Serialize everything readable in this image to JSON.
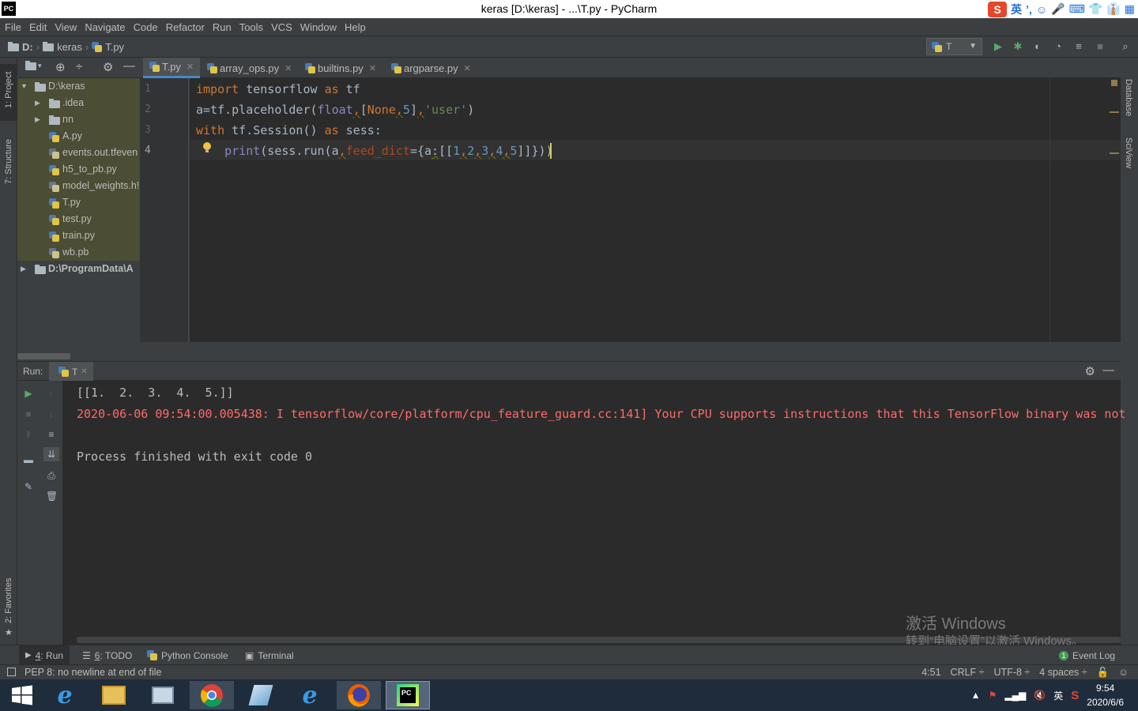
{
  "window": {
    "title": "keras [D:\\keras] - ...\\T.py - PyCharm",
    "app_logo": "PC"
  },
  "ime": {
    "lang": "英",
    "items": [
      "ʼ,",
      "☺",
      "🎤",
      "⌨",
      "👕",
      "👔",
      "▦"
    ]
  },
  "menu": [
    "File",
    "Edit",
    "View",
    "Navigate",
    "Code",
    "Refactor",
    "Run",
    "Tools",
    "VCS",
    "Window",
    "Help"
  ],
  "breadcrumb": {
    "drive": "D:",
    "folder": "keras",
    "file": "T.py"
  },
  "run_config": {
    "name": "T"
  },
  "left_strip": {
    "project": "1: Project",
    "structure": "7: Structure",
    "favorites": "2: Favorites"
  },
  "right_strip": {
    "database": "Database",
    "sciview": "SciView"
  },
  "project_tree": [
    {
      "label": "D:\\keras",
      "type": "folder",
      "level": 0,
      "expanded": true
    },
    {
      "label": ".idea",
      "type": "folder",
      "level": 1,
      "expanded": false
    },
    {
      "label": "nn",
      "type": "folder",
      "level": 1,
      "expanded": false
    },
    {
      "label": "A.py",
      "type": "py",
      "level": 1
    },
    {
      "label": "events.out.tfeven",
      "type": "file",
      "level": 1
    },
    {
      "label": "h5_to_pb.py",
      "type": "py",
      "level": 1
    },
    {
      "label": "model_weights.h!",
      "type": "file",
      "level": 1
    },
    {
      "label": "T.py",
      "type": "py",
      "level": 1
    },
    {
      "label": "test.py",
      "type": "py",
      "level": 1
    },
    {
      "label": "train.py",
      "type": "py",
      "level": 1
    },
    {
      "label": "wb.pb",
      "type": "file",
      "level": 1
    },
    {
      "label": "D:\\ProgramData\\A",
      "type": "folder",
      "level": 0,
      "expanded": false
    }
  ],
  "tabs": [
    {
      "label": "T.py",
      "active": true
    },
    {
      "label": "array_ops.py",
      "active": false
    },
    {
      "label": "builtins.py",
      "active": false
    },
    {
      "label": "argparse.py",
      "active": false
    }
  ],
  "line_numbers": [
    "1",
    "2",
    "3",
    "4"
  ],
  "code": {
    "l1_import": "import",
    "l1_mod": " tensorflow ",
    "l1_as": "as",
    "l1_alias": " tf",
    "l2_a": "a=tf.placeholder(",
    "l2_float": "float",
    "l2_comma1": ",",
    "l2_list_open": "[",
    "l2_none": "None",
    "l2_comma2": ",",
    "l2_five": "5",
    "l2_list_close": "]",
    "l2_comma3": ",",
    "l2_str": "'user'",
    "l2_close": ")",
    "l3_with": "with",
    "l3_body": " tf.Session() ",
    "l3_as": "as",
    "l3_tail": " sess:",
    "l4_indent": "    ",
    "l4_print": "print",
    "l4_p1": "(sess.run(a",
    "l4_comma": ",",
    "l4_kw": "feed_dict",
    "l4_eq": "={a",
    "l4_colon": ":",
    "l4_list": "[[",
    "l4_n1": "1",
    "l4_n2": "2",
    "l4_n3": "3",
    "l4_n4": "4",
    "l4_n5": "5",
    "l4_c": ",",
    "l4_end": "]]}))"
  },
  "run_panel": {
    "label": "Run:",
    "config": "T",
    "output": [
      {
        "text": "[[1.  2.  3.  4.  5.]]",
        "color": "#bbbbbb"
      },
      {
        "text": "2020-06-06 09:54:00.005438: I tensorflow/core/platform/cpu_feature_guard.cc:141] Your CPU supports instructions that this TensorFlow binary was not",
        "color": "#ff6b68"
      },
      {
        "text": "",
        "color": "#bbbbbb"
      },
      {
        "text": "Process finished with exit code 0",
        "color": "#bbbbbb"
      }
    ]
  },
  "watermark": {
    "line1": "激活 Windows",
    "line2": "转到“电脑设置”以激活 Windows。"
  },
  "bottom_tabs": [
    {
      "key": "4",
      "label": ": Run",
      "icon": "play-icon",
      "active": true
    },
    {
      "key": "6",
      "label": ": TODO",
      "icon": "list-icon",
      "active": false
    },
    {
      "key": "",
      "label": "Python Console",
      "icon": "python-console-icon",
      "active": false
    },
    {
      "key": "",
      "label": "Terminal",
      "icon": "terminal-icon",
      "active": false
    }
  ],
  "event_log": {
    "count": "1",
    "label": "Event Log"
  },
  "status": {
    "message": "PEP 8: no newline at end of file",
    "position": "4:51",
    "line_sep": "CRLF ÷",
    "encoding": "UTF-8 ÷",
    "indent": "4 spaces ÷"
  },
  "taskbar": {
    "apps": [
      "start-icon",
      "ie-icon",
      "file-explorer-icon",
      "control-panel-icon",
      "chrome-icon",
      "pen-icon",
      "ie-icon",
      "firefox-icon",
      "pycharm-icon"
    ],
    "tray_lang": "英",
    "time": "9:54",
    "date": "2020/6/6"
  },
  "colors": {
    "accent": "#4a88c7",
    "error": "#ff6b68",
    "keyword": "#cc7832",
    "string": "#6a8759",
    "number": "#6897bb"
  }
}
